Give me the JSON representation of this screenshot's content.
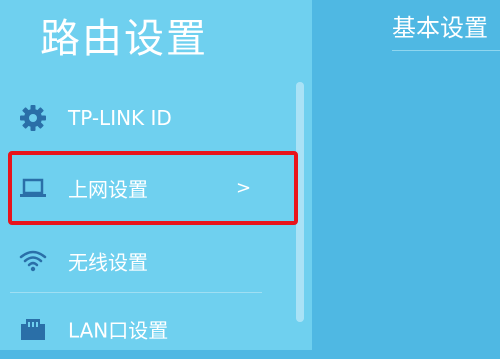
{
  "sidebar": {
    "title": "路由设置",
    "items": [
      {
        "label": "TP-LINK ID",
        "icon": "gear-icon"
      },
      {
        "label": "上网设置",
        "icon": "laptop-icon",
        "chevron": ">"
      },
      {
        "label": "无线设置",
        "icon": "wifi-icon"
      },
      {
        "label": "LAN口设置",
        "icon": "lan-port-icon"
      }
    ]
  },
  "main": {
    "section_title": "基本设置"
  },
  "colors": {
    "sidebar_bg": "#6fd0ef",
    "main_bg": "#4fb8e3",
    "highlight_border": "#e8141b",
    "icon": "#2a6fa8"
  }
}
